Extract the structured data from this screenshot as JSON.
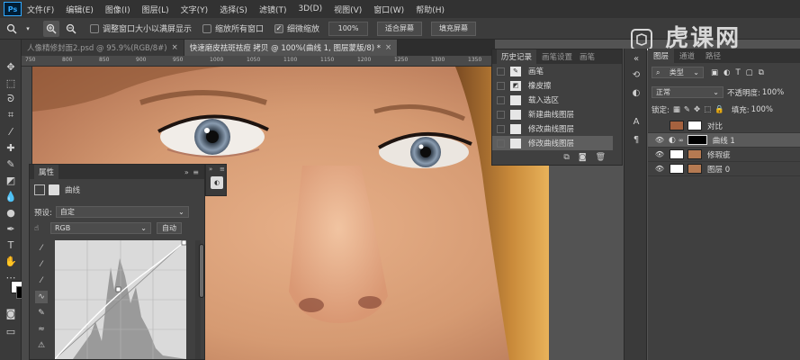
{
  "menu": {
    "logo": "Ps",
    "items": [
      "文件(F)",
      "编辑(E)",
      "图像(I)",
      "图层(L)",
      "文字(Y)",
      "选择(S)",
      "滤镜(T)",
      "3D(D)",
      "视图(V)",
      "窗口(W)",
      "帮助(H)"
    ]
  },
  "options": {
    "resize_windows_label": "调整窗口大小以满屏显示",
    "zoom_all_label": "缩放所有窗口",
    "scrubby_zoom_label": "细微缩放",
    "zoom_value": "100%",
    "fit_screen_label": "适合屏幕",
    "fill_screen_label": "填充屏幕"
  },
  "watermark": "虎课网",
  "tabs": [
    {
      "label": "人像精修封面2.psd @ 95.9%(RGB/8#)",
      "close": "×"
    },
    {
      "label": "快速磨皮祛斑祛痘 拷贝 @ 100%(曲线 1, 图层蒙版/8) *",
      "close": "×"
    }
  ],
  "ruler": {
    "ticks": [
      "750",
      "800",
      "850",
      "900",
      "950",
      "1000",
      "1050",
      "1100",
      "1150",
      "1200",
      "1250",
      "1300",
      "1350"
    ]
  },
  "properties": {
    "tab": "属性",
    "collapse": "»",
    "menu": "≡",
    "title": "曲线",
    "preset_label": "预设:",
    "preset_value": "自定",
    "channel_value": "RGB",
    "auto_label": "自动"
  },
  "history": {
    "tabs": [
      "历史记录",
      "画笔设置",
      "画笔"
    ],
    "items": [
      {
        "label": "画笔",
        "active": false
      },
      {
        "label": "橡皮擦",
        "active": false
      },
      {
        "label": "载入选区",
        "active": false
      },
      {
        "label": "新建曲线图层",
        "active": false
      },
      {
        "label": "修改曲线图层",
        "active": false
      },
      {
        "label": "修改曲线图层",
        "active": true
      }
    ]
  },
  "layers": {
    "tabs": [
      "图层",
      "通道",
      "路径"
    ],
    "filter_label": "类型",
    "blend_mode": "正常",
    "opacity_label": "不透明度:",
    "opacity_value": "100%",
    "lock_label": "锁定:",
    "fill_label": "填充:",
    "fill_value": "100%",
    "items": [
      {
        "name": "对比",
        "visible": false,
        "active": false
      },
      {
        "name": "曲线 1",
        "visible": true,
        "active": true
      },
      {
        "name": "修瑕疵",
        "visible": true,
        "active": false
      },
      {
        "name": "图层 0",
        "visible": true,
        "active": false
      }
    ]
  },
  "colors": {
    "accent": "#31a8ff",
    "panel": "#404040",
    "header": "#323232"
  }
}
